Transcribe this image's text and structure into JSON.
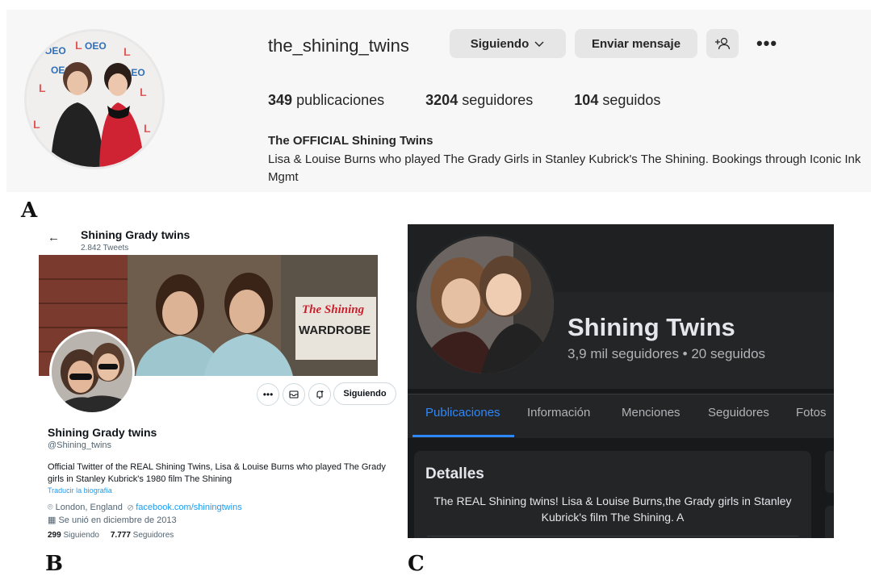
{
  "labels": {
    "a": "A",
    "b": "B",
    "c": "C"
  },
  "instagram": {
    "username": "the_shining_twins",
    "following_button": "Siguiendo",
    "message_button": "Enviar mensaje",
    "more_icon": "•••",
    "posts_count": "349",
    "posts_label": "publicaciones",
    "followers_count": "3204",
    "followers_label": "seguidores",
    "following_count": "104",
    "following_label": "seguidos",
    "full_name": "The OFFICIAL Shining Twins",
    "bio": "Lisa & Louise Burns who played The Grady Girls in Stanley Kubrick's The Shining. Bookings through Iconic Ink Mgmt",
    "avatar_text": "LOEO"
  },
  "twitter": {
    "back_icon": "←",
    "header_name": "Shining Grady twins",
    "tweet_count": "2.842 Tweets",
    "banner_sign_top": "The Shining",
    "banner_sign_bottom": "WARDROBE",
    "following_button": "Siguiendo",
    "name": "Shining Grady twins",
    "handle": "@Shining_twins",
    "bio": "Official Twitter of the REAL Shining Twins, Lisa & Louise Burns who played The Grady girls in Stanley Kubrick's 1980 film The Shining",
    "translate": "Traducir la biografía",
    "location": "London, England",
    "link": "facebook.com/shiningtwins",
    "joined": "Se unió en diciembre de 2013",
    "following_count": "299",
    "following_label": "Siguiendo",
    "followers_count": "7.777",
    "followers_label": "Seguidores"
  },
  "facebook": {
    "page_name": "Shining Twins",
    "stats": "3,9 mil seguidores • 20 seguidos",
    "tabs": [
      "Publicaciones",
      "Información",
      "Menciones",
      "Seguidores",
      "Fotos"
    ],
    "details_title": "Detalles",
    "details_text": "The REAL Shining twins! Lisa & Louise Burns,the Grady girls in Stanley Kubrick's film The Shining. A"
  }
}
